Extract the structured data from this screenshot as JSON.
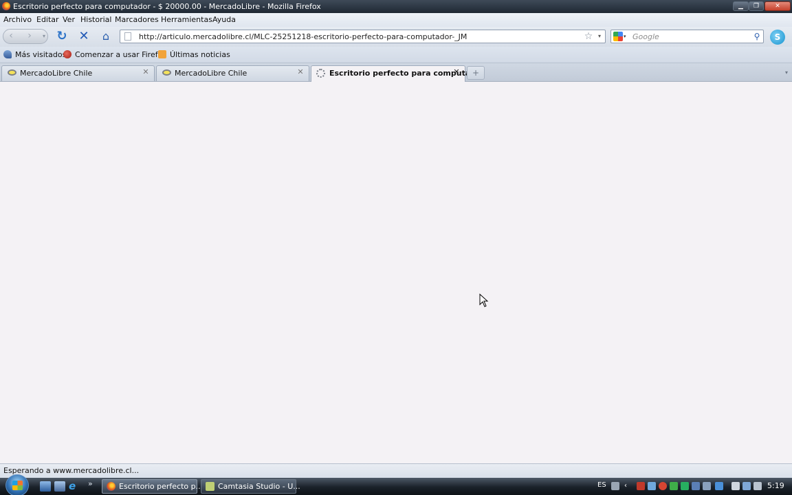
{
  "window": {
    "title": "Escritorio perfecto para computador - $ 20000.00 - MercadoLibre - Mozilla Firefox",
    "minimize_symbol": "▁",
    "maximize_symbol": "❐",
    "close_symbol": "✕"
  },
  "menu": [
    {
      "label": "Archivo"
    },
    {
      "label": "Editar"
    },
    {
      "label": "Ver"
    },
    {
      "label": "Historial"
    },
    {
      "label": "Marcadores"
    },
    {
      "label": "Herramientas"
    },
    {
      "label": "Ayuda"
    }
  ],
  "navigation": {
    "back_symbol": "‹",
    "forward_symbol": "›",
    "reload_symbol": "↻",
    "stop_symbol": "✕",
    "home_symbol": "⌂",
    "url": "http://articulo.mercadolibre.cl/MLC-25251218-escritorio-perfecto-para-computador-_JM",
    "bookmark_symbol": "☆",
    "search_placeholder": "Google",
    "search_symbol": "⚲",
    "skype_symbol": "S"
  },
  "bookmarks": [
    {
      "label": "Más visitados",
      "icon": "most-visited-icon"
    },
    {
      "label": "Comenzar a usar Firefox",
      "icon": "firefox-start-icon"
    },
    {
      "label": "Últimas noticias",
      "icon": "rss-feed-icon"
    }
  ],
  "tabs": [
    {
      "label": "MercadoLibre Chile",
      "active": false,
      "close": "✕"
    },
    {
      "label": "MercadoLibre Chile",
      "active": false,
      "close": "✕"
    },
    {
      "label": "Escritorio perfecto para computa...",
      "active": true,
      "loading": true,
      "close": "✕"
    }
  ],
  "new_tab_symbol": "+",
  "status": {
    "text": "Esperando a www.mercadolibre.cl..."
  },
  "taskbar": {
    "more_symbol": "»",
    "ie_symbol": "e",
    "tasks": [
      {
        "label": "Escritorio perfecto p...",
        "icon": "firefox-icon"
      },
      {
        "label": "Camtasia Studio - U...",
        "icon": "camtasia-icon"
      }
    ],
    "language": "ES",
    "clock": "5:19"
  },
  "colors": {
    "content_background": "#f4f2f5",
    "accent_blue": "#2b72c8"
  }
}
